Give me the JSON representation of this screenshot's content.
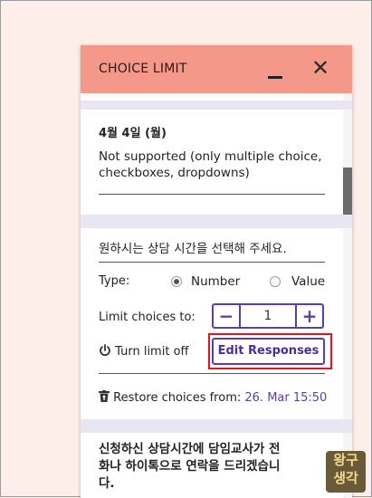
{
  "header": {
    "title": "CHOICE LIMIT"
  },
  "question1": {
    "title": "4월 4일 (월)",
    "message": [
      "Not supported (only multiple choice,",
      "checkboxes, dropdowns)"
    ]
  },
  "question2": {
    "title": "원하시는 상담 시간을 선택해 주세요.",
    "type_label": "Type:",
    "type_options": [
      "Number",
      "Value"
    ],
    "type_selected": "Number",
    "limit_label": "Limit choices to:",
    "limit_value": "1",
    "turn_off_label": "Turn limit off",
    "edit_label": "Edit Responses",
    "restore_label": "Restore choices from:",
    "restore_date": "26. Mar 15:50"
  },
  "question3": {
    "title_lines": [
      "신청하신 상담시간에 담임교사가 전",
      "화나 하이톡으로 연락을 드리겠습니",
      "다."
    ]
  },
  "watermark": [
    "왕구",
    "생각"
  ],
  "colors": {
    "header": "#f4998a",
    "accent": "#5a3fa8",
    "highlight": "#e3141c",
    "band": "#e9e5f3"
  }
}
